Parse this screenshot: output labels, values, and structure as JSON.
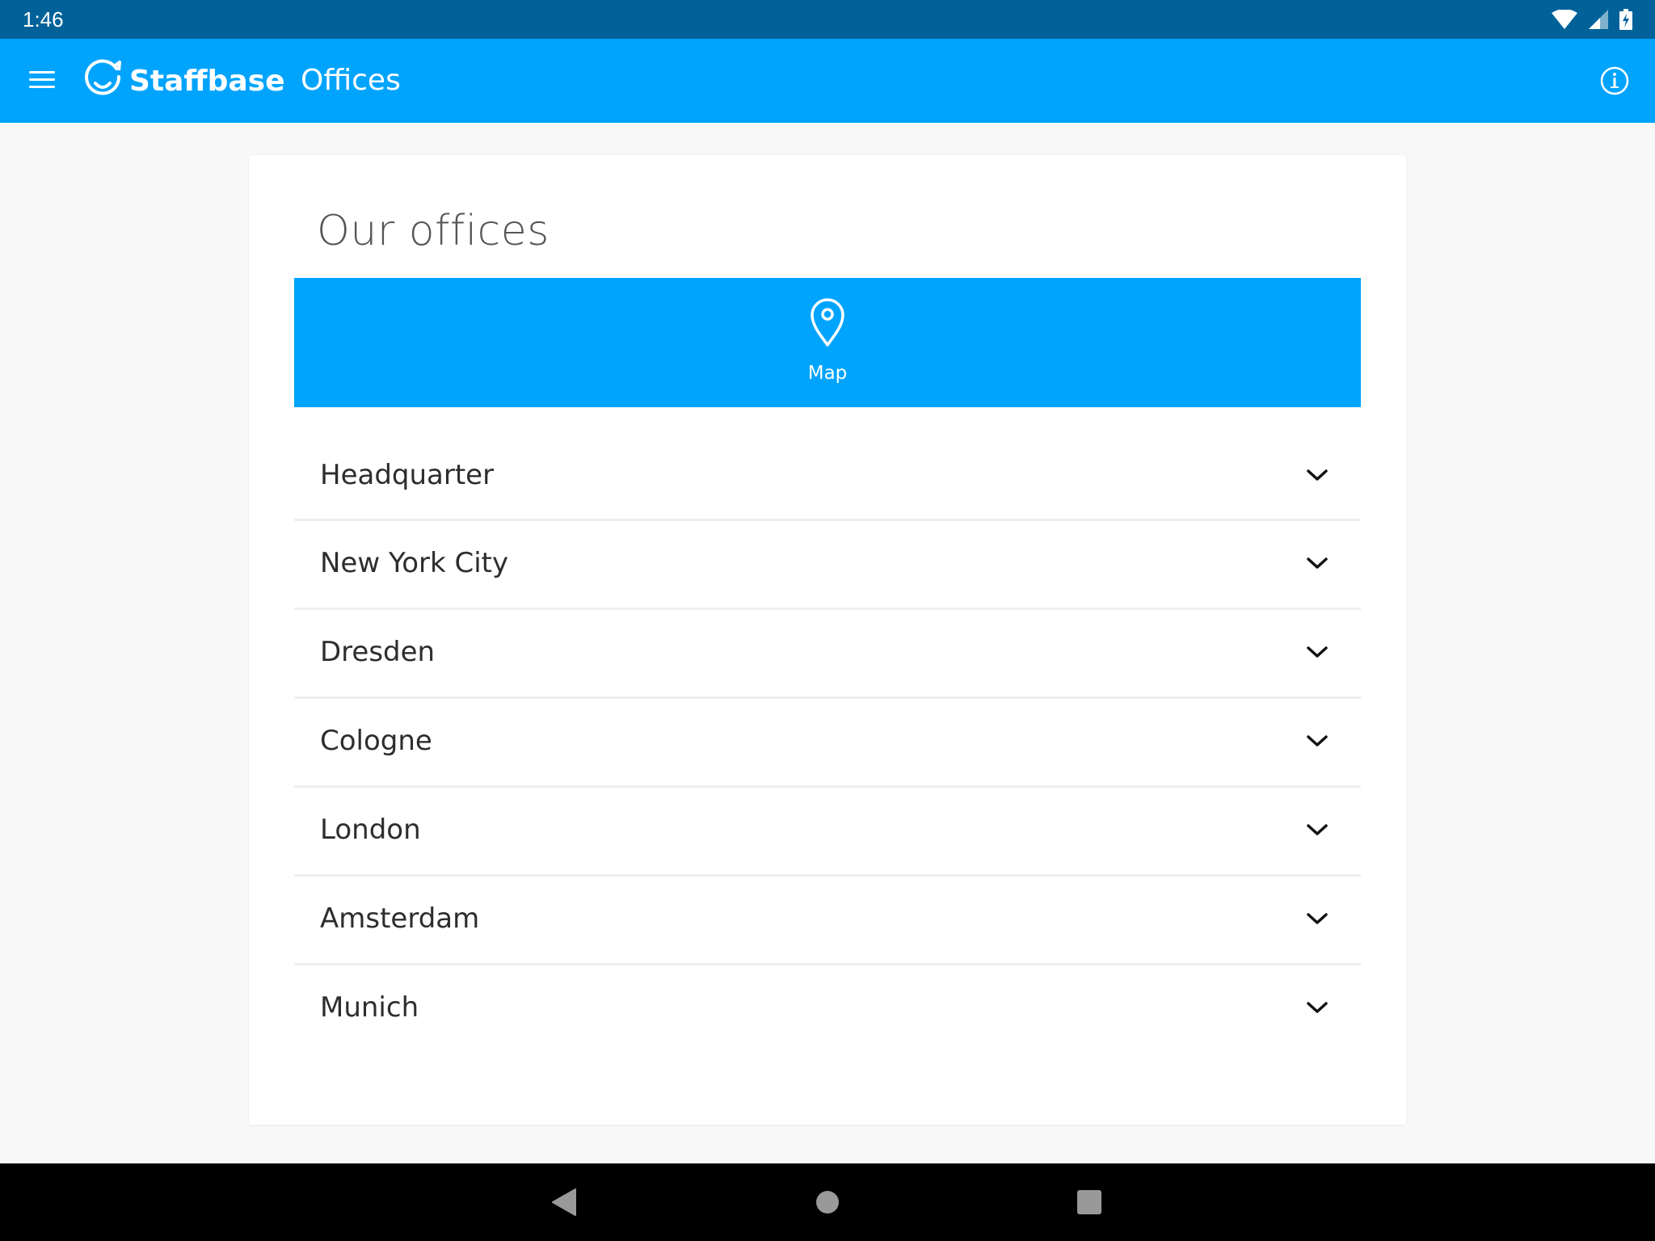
{
  "status_bar": {
    "time": "1:46",
    "icons": [
      "wifi-icon",
      "signal-icon",
      "battery-charging-icon"
    ]
  },
  "app_bar": {
    "menu_icon": "hamburger-menu-icon",
    "brand_name": "Staffbase",
    "brand_icon": "staffbase-logo-icon",
    "page_title": "Offices",
    "info_icon": "info-icon"
  },
  "colors": {
    "status_bar": "#01629a",
    "primary": "#00a4fd",
    "background": "#f8f8f8",
    "card": "#ffffff",
    "divider": "#eeeeee",
    "text": "#2d2d2d",
    "title_text": "#555555"
  },
  "main": {
    "title": "Our offices",
    "map_button": {
      "icon": "map-pin-icon",
      "label": "Map"
    },
    "offices": [
      {
        "name": "Headquarter",
        "icon": "chevron-down-icon"
      },
      {
        "name": "New York City",
        "icon": "chevron-down-icon"
      },
      {
        "name": "Dresden",
        "icon": "chevron-down-icon"
      },
      {
        "name": "Cologne",
        "icon": "chevron-down-icon"
      },
      {
        "name": "London",
        "icon": "chevron-down-icon"
      },
      {
        "name": "Amsterdam",
        "icon": "chevron-down-icon"
      },
      {
        "name": "Munich",
        "icon": "chevron-down-icon"
      }
    ]
  },
  "nav_bar": {
    "buttons": [
      "back-icon",
      "home-icon",
      "recents-icon"
    ]
  }
}
